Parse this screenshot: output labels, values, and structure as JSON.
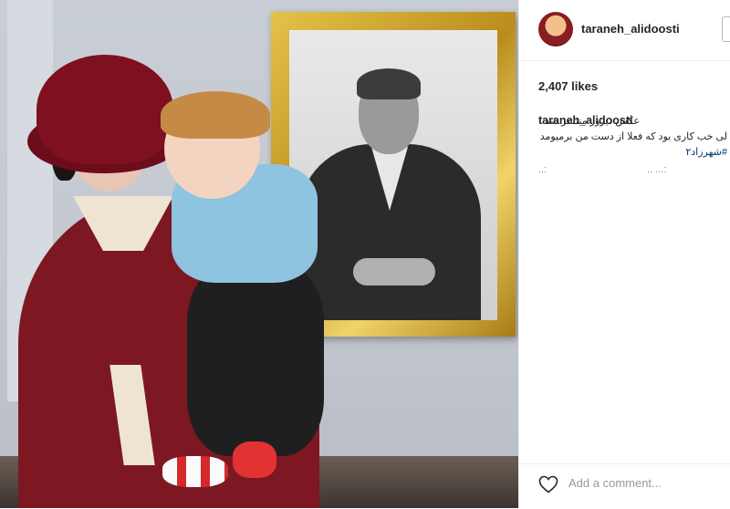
{
  "post": {
    "username": "taraneh_alidoosti",
    "likes": "2,407 likes",
    "caption": {
      "username": "taraneh_alidoosti",
      "line1": "عکس دیروز منتشر شد",
      "line2": "لی خب کاری بود که فعلا از دست من برمیومد",
      "line3": "#شهرزاد۲",
      "dots1": "..:",
      "dots2": ".. ...:"
    },
    "comment_placeholder": "Add a comment..."
  },
  "icons": {
    "heart": "heart-icon",
    "avatar": "avatar"
  },
  "colors": {
    "text": "#262626",
    "hashtag": "#003569",
    "muted": "#999999",
    "border": "#efefef"
  }
}
